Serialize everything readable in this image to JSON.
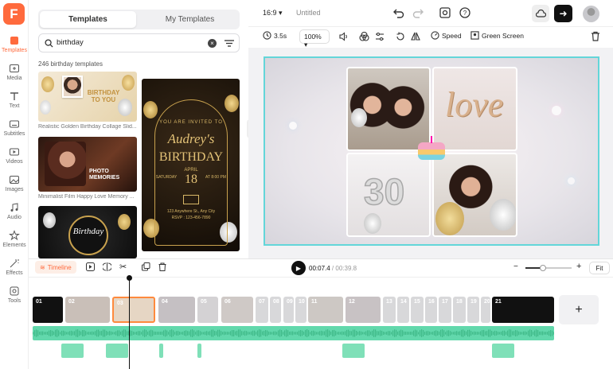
{
  "app": {
    "logo_letter": "F",
    "project_title": "Untitled",
    "aspect": "16:9",
    "accent": "#ff6a3d",
    "selection_color": "#63d6d9"
  },
  "nav": [
    {
      "label": "Templates",
      "icon": "templates-icon",
      "active": true
    },
    {
      "label": "Media",
      "icon": "media-icon"
    },
    {
      "label": "Text",
      "icon": "text-icon"
    },
    {
      "label": "Subtitles",
      "icon": "subtitles-icon"
    },
    {
      "label": "Videos",
      "icon": "videos-icon"
    },
    {
      "label": "Images",
      "icon": "images-icon"
    },
    {
      "label": "Audio",
      "icon": "audio-icon"
    },
    {
      "label": "Elements",
      "icon": "elements-icon"
    },
    {
      "label": "Effects",
      "icon": "effects-icon"
    },
    {
      "label": "Tools",
      "icon": "tools-icon"
    }
  ],
  "panel": {
    "tabs": [
      "Templates",
      "My Templates"
    ],
    "search_value": "birthday",
    "results_count": "246 birthday templates",
    "templates": [
      {
        "caption": "Realistic Golden Birthday Collage Slid...",
        "text_lines": [
          "BIRTHDAY",
          "TO YOU"
        ]
      },
      {
        "caption": "Minimalist Film Happy Love Memory ...",
        "text_lines": [
          "PHOTO",
          "MEMORIES"
        ]
      },
      {
        "caption": "",
        "text_lines": [
          "Birthday"
        ]
      },
      {
        "caption": "",
        "text_lines": [
          "YOU ARE INVITED TO",
          "Audrey's",
          "BIRTHDAY",
          "APRIL",
          "18",
          "SATURDAY",
          "AT 8:00 PM",
          "123 Anywhere St., Any City",
          "RSVP : 123-456-7890"
        ]
      }
    ]
  },
  "toolbar": {
    "duration": "3.5s",
    "zoom": "100%",
    "speed": "Speed",
    "green_screen": "Green Screen"
  },
  "canvas": {
    "balloon_text": "love",
    "balloon_number": "30"
  },
  "timeline": {
    "label": "Timeline",
    "current_time": "00:07.4",
    "total_time": "00:39.8",
    "fit": "Fit",
    "clip_numbers": [
      "01",
      "02",
      "03",
      "04",
      "05",
      "06",
      "07",
      "08",
      "09",
      "10",
      "11",
      "12",
      "13",
      "14",
      "15",
      "16",
      "17",
      "18",
      "19",
      "20",
      "21"
    ],
    "add": "+"
  }
}
